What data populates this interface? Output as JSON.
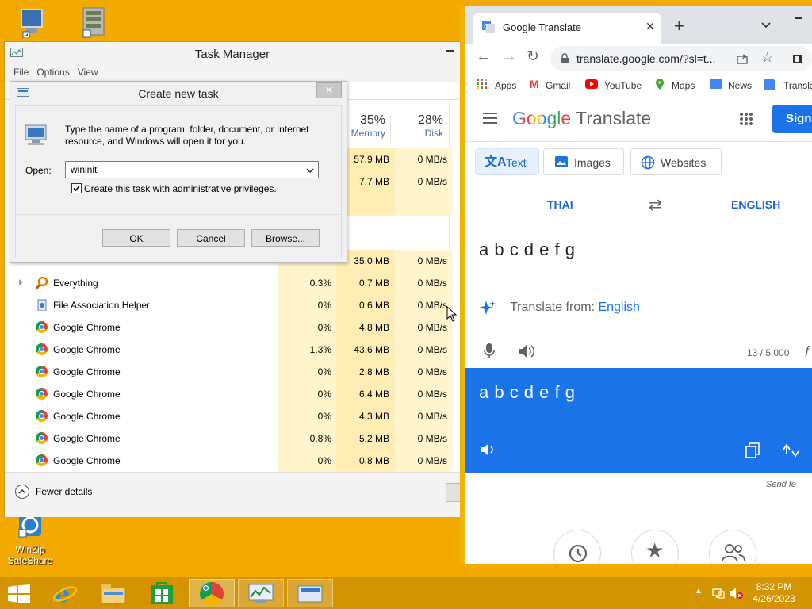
{
  "desktop": {
    "winzip_label_1": "WinZip",
    "winzip_label_2": "SafeShare"
  },
  "task_manager": {
    "title": "Task Manager",
    "menu": [
      "File",
      "Options",
      "View"
    ],
    "columns": {
      "memory_pct": "35%",
      "memory_label": "Memory",
      "disk_pct": "28%",
      "disk_label": "Disk"
    },
    "partial_rows": [
      {
        "memory": "57.9 MB",
        "disk": "0 MB/s"
      },
      {
        "memory": "7.7 MB",
        "disk": "0 MB/s"
      },
      {
        "memory": "",
        "disk": ""
      },
      {
        "memory": "35.0 MB",
        "disk": "0 MB/s"
      }
    ],
    "rows": [
      {
        "name": "Everything",
        "cpu": "0.3%",
        "memory": "0.7 MB",
        "disk": "0 MB/s"
      },
      {
        "name": "File Association Helper",
        "cpu": "0%",
        "memory": "0.6 MB",
        "disk": "0 MB/s"
      },
      {
        "name": "Google Chrome",
        "cpu": "0%",
        "memory": "4.8 MB",
        "disk": "0 MB/s"
      },
      {
        "name": "Google Chrome",
        "cpu": "1.3%",
        "memory": "43.6 MB",
        "disk": "0 MB/s"
      },
      {
        "name": "Google Chrome",
        "cpu": "0%",
        "memory": "2.8 MB",
        "disk": "0 MB/s"
      },
      {
        "name": "Google Chrome",
        "cpu": "0%",
        "memory": "6.4 MB",
        "disk": "0 MB/s"
      },
      {
        "name": "Google Chrome",
        "cpu": "0%",
        "memory": "4.3 MB",
        "disk": "0 MB/s"
      },
      {
        "name": "Google Chrome",
        "cpu": "0.8%",
        "memory": "5.2 MB",
        "disk": "0 MB/s"
      },
      {
        "name": "Google Chrome",
        "cpu": "0%",
        "memory": "0.8 MB",
        "disk": "0 MB/s"
      }
    ],
    "fewer_details": "Fewer details"
  },
  "dialog": {
    "title": "Create new task",
    "description_1": "Type the name of a program, folder, document, or Internet",
    "description_2": "resource, and Windows will open it for you.",
    "open_label": "Open:",
    "open_value": "wininit",
    "admin_label": "Create this task with administrative privileges.",
    "admin_checked": true,
    "ok": "OK",
    "cancel": "Cancel",
    "browse": "Browse..."
  },
  "browser": {
    "tab_title": "Google Translate",
    "url": "translate.google.com/?sl=t...",
    "bookmarks": [
      "Apps",
      "Gmail",
      "YouTube",
      "Maps",
      "News",
      "Transla"
    ],
    "brand_google": "Google",
    "brand_translate": "Translate",
    "sign_in": "Sign",
    "modes": [
      "Text",
      "Images",
      "Websites"
    ],
    "source_lang": "THAI",
    "target_lang": "ENGLISH",
    "source_text": "a b c d e f g",
    "translate_from_prefix": "Translate from: ",
    "translate_from_lang": "English",
    "char_count": "13 / 5,000",
    "result_text": "a b c d e f g",
    "send_feedback": "Send fe"
  },
  "taskbar": {
    "time": "8:32 PM",
    "date": "4/26/2023"
  },
  "colors": {
    "desktop": "#f2a900",
    "taskbar": "#d39400",
    "google_blue": "#1a73e8",
    "result_bg": "#1a73e8"
  }
}
